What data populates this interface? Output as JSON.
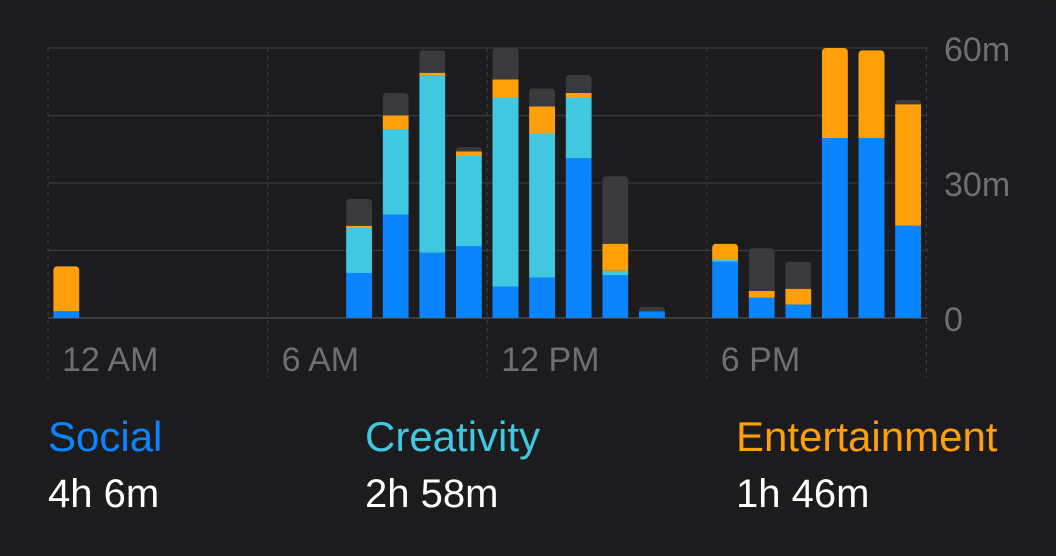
{
  "colors": {
    "background": "#1c1c1e",
    "social": "#0a84ff",
    "creativity": "#40c8e0",
    "entertainment": "#ff9f0a",
    "other": "#3a3a3c",
    "grid": "#3a3a3c",
    "axis_text": "#6e6e73"
  },
  "chart_data": {
    "type": "bar",
    "stacked": true,
    "x_ticks": [
      "12 AM",
      "6 AM",
      "12 PM",
      "6 PM"
    ],
    "y_ticks": [
      "60m",
      "30m",
      "0"
    ],
    "ylim": [
      0,
      60
    ],
    "grid": true,
    "categories": [
      "0",
      "1",
      "2",
      "3",
      "4",
      "5",
      "6",
      "7",
      "8",
      "9",
      "10",
      "11",
      "12",
      "13",
      "14",
      "15",
      "16",
      "17",
      "18",
      "19",
      "20",
      "21",
      "22",
      "23"
    ],
    "series": [
      {
        "name": "Social",
        "color": "#0a84ff",
        "values": [
          1.5,
          0,
          0,
          0,
          0,
          0,
          0,
          0,
          10,
          23,
          14.5,
          16,
          7,
          9,
          35.5,
          9.5,
          1.5,
          0,
          12.5,
          4.5,
          3,
          40,
          40,
          20.5
        ]
      },
      {
        "name": "Creativity",
        "color": "#40c8e0",
        "values": [
          0,
          0,
          0,
          0,
          0,
          0,
          0,
          0,
          10,
          19,
          39.5,
          20,
          42,
          32,
          13.5,
          1,
          0,
          0,
          0.5,
          0,
          0,
          0,
          0,
          0
        ]
      },
      {
        "name": "Entertainment",
        "color": "#ff9f0a",
        "values": [
          10,
          0,
          0,
          0,
          0,
          0,
          0,
          0,
          0.5,
          3,
          0.5,
          1,
          4,
          6,
          1,
          6,
          0,
          0,
          3.5,
          1.5,
          3.5,
          20,
          19.5,
          27
        ]
      },
      {
        "color": "#3a3a3c",
        "values": [
          0,
          0,
          0,
          0,
          0,
          0,
          0,
          0.2,
          6,
          5,
          5,
          1,
          7,
          4,
          4,
          15,
          1,
          0,
          0,
          9.5,
          6,
          0,
          0,
          1
        ]
      }
    ]
  },
  "legend": [
    {
      "name": "Social",
      "value": "4h 6m",
      "color": "#0a84ff"
    },
    {
      "name": "Creativity",
      "value": "2h 58m",
      "color": "#40c8e0"
    },
    {
      "name": "Entertainment",
      "value": "1h 46m",
      "color": "#ff9f0a"
    }
  ]
}
